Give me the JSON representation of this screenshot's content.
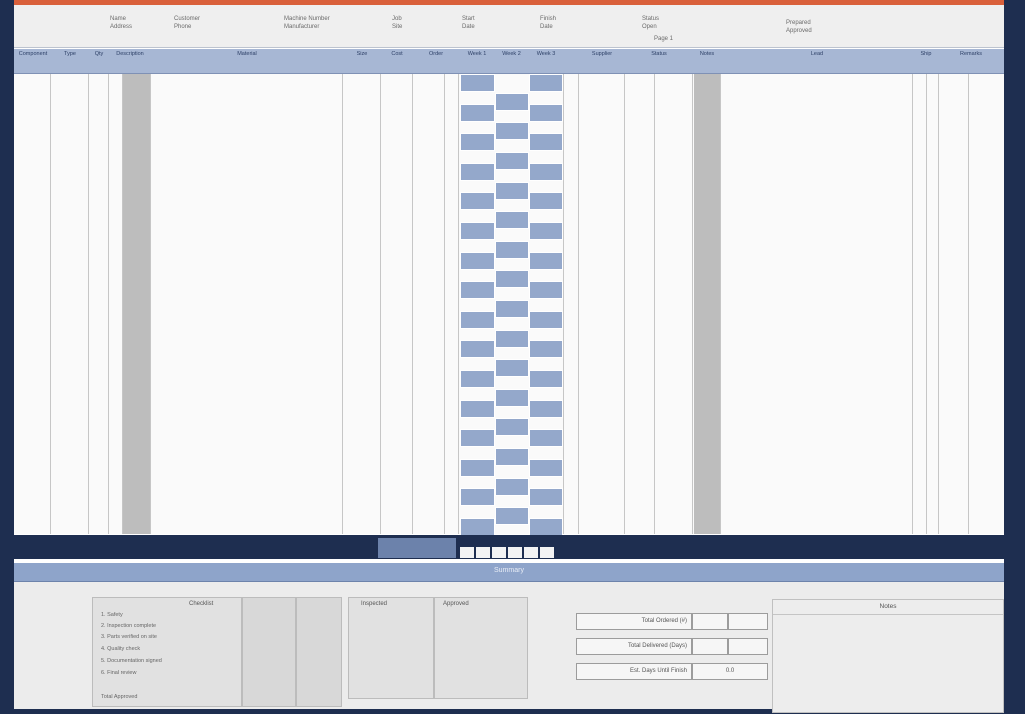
{
  "header": {
    "fields": [
      {
        "label": "Name",
        "value": "Address"
      },
      {
        "label": "Customer",
        "value": "Phone"
      },
      {
        "label": "Machine Number",
        "value": "Manufacturer"
      },
      {
        "label": "Job",
        "value": "Site"
      },
      {
        "label": "Start",
        "value": "Date"
      },
      {
        "label": "Finish",
        "value": "Date"
      },
      {
        "label": "Status",
        "value": "Open"
      },
      {
        "label": "Prepared",
        "value": "Approved"
      }
    ],
    "page_label": "Page 1"
  },
  "columns": [
    "Component",
    "Type",
    "Qty",
    "Description",
    "Material",
    "Size",
    "Cost",
    "Order",
    "Week 1",
    "Week 2",
    "Week 3",
    "Supplier",
    "Status",
    "Notes",
    "Lead",
    "Ship",
    "Remarks"
  ],
  "weeks": {
    "week1": [
      1,
      0,
      1,
      0,
      1,
      0,
      1,
      0,
      1,
      0,
      1,
      0,
      1,
      0,
      1,
      0,
      1,
      0,
      1,
      0,
      1,
      0,
      1,
      0,
      1,
      0,
      1,
      0,
      1,
      0,
      1
    ],
    "week2": [
      0,
      1,
      0,
      1,
      0,
      1,
      0,
      1,
      0,
      1,
      0,
      1,
      0,
      1,
      0,
      1,
      0,
      1,
      0,
      1,
      0,
      1,
      0,
      1,
      0,
      1,
      0,
      1,
      0,
      1,
      0
    ],
    "week3": [
      1,
      0,
      1,
      0,
      1,
      0,
      1,
      0,
      1,
      0,
      1,
      0,
      1,
      0,
      1,
      0,
      1,
      0,
      1,
      0,
      1,
      0,
      1,
      0,
      1,
      0,
      1,
      0,
      1,
      0,
      1
    ]
  },
  "section_title": "Summary",
  "checklist": {
    "title": "Checklist",
    "items": [
      "1. Safety",
      "2. Inspection complete",
      "3. Parts verified on site",
      "4. Quality check",
      "5. Documentation signed",
      "6. Final review",
      "Total Approved"
    ]
  },
  "counts": {
    "col1_title": "Inspected",
    "col2_title": "Approved"
  },
  "totals": [
    {
      "label": "Total Ordered (#)",
      "value": ""
    },
    {
      "label": "Total Delivered (Days)",
      "value": ""
    },
    {
      "label": "Est. Days Until Finish",
      "value": "0.0"
    }
  ],
  "notes": {
    "title": "Notes"
  },
  "colors": {
    "frame": "#1e2e50",
    "accent": "#d9603b",
    "header_band": "#a7b7d4",
    "highlight": "#94a8cb"
  }
}
